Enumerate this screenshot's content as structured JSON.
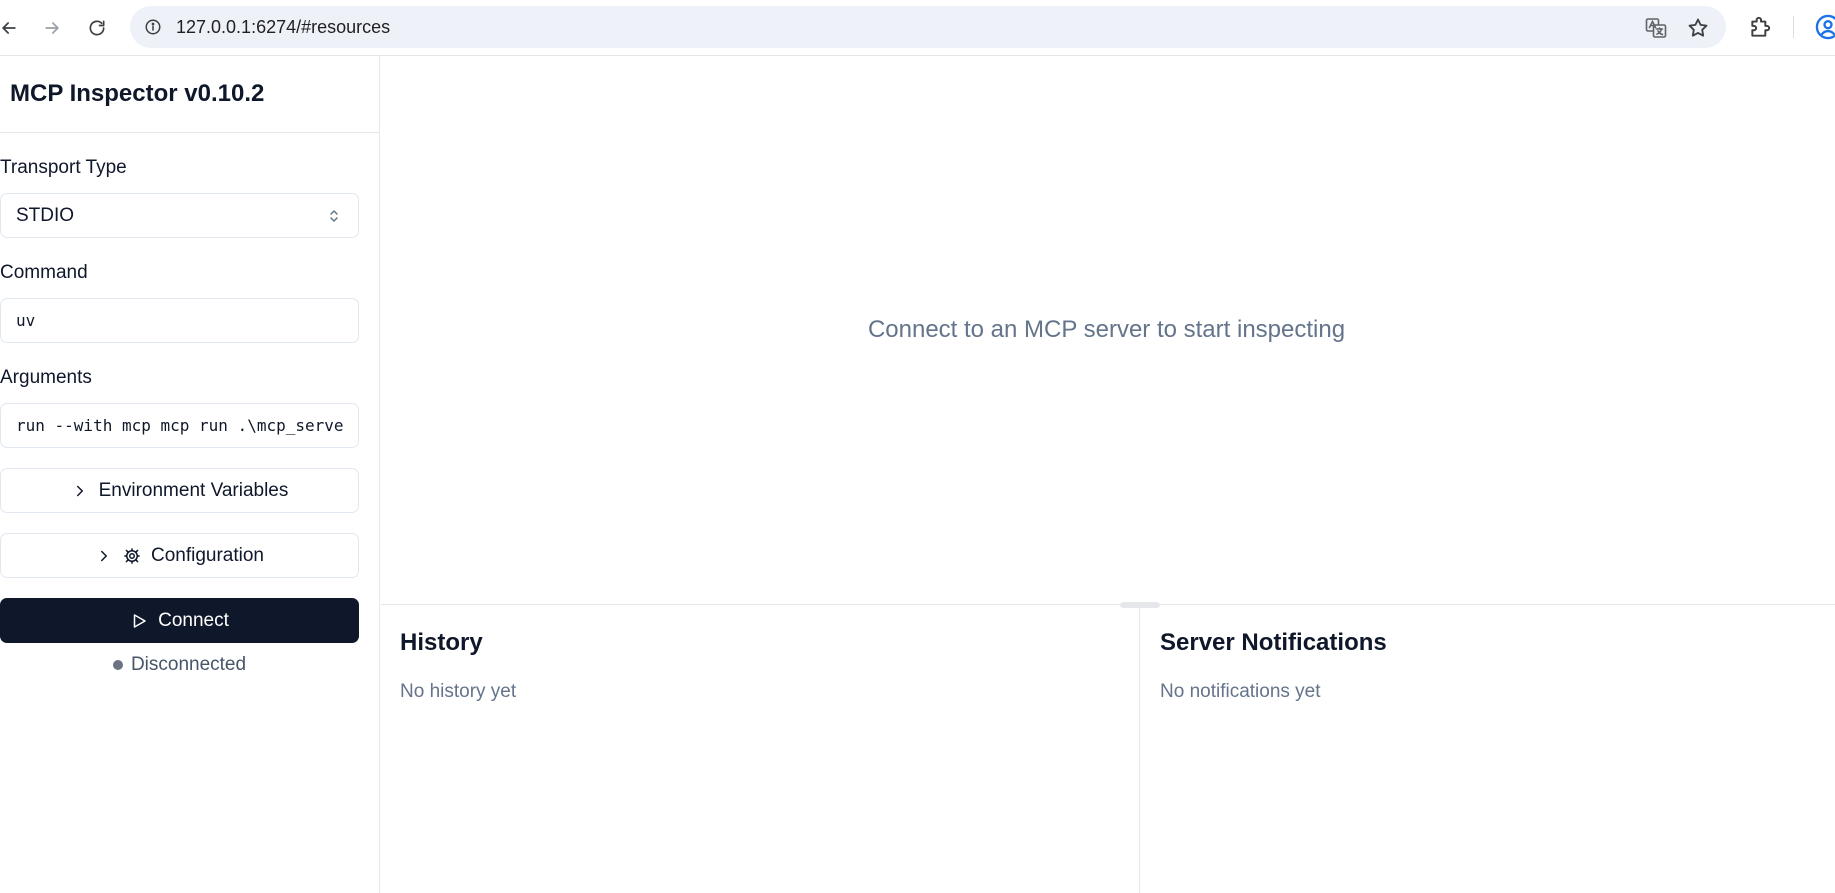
{
  "browser": {
    "url": "127.0.0.1:6274/#resources"
  },
  "sidebar": {
    "title": "MCP Inspector v0.10.2",
    "transport_label": "Transport Type",
    "transport_value": "STDIO",
    "command_label": "Command",
    "command_value": "uv",
    "arguments_label": "Arguments",
    "arguments_value": "run --with mcp mcp run .\\mcp_serve",
    "env_button_label": "Environment Variables",
    "config_button_label": "Configuration",
    "connect_button_label": "Connect",
    "status_text": "Disconnected",
    "status_color": "#6b7280"
  },
  "main": {
    "empty_message": "Connect to an MCP server to start inspecting"
  },
  "history": {
    "title": "History",
    "empty_text": "No history yet"
  },
  "notifications": {
    "title": "Server Notifications",
    "empty_text": "No notifications yet"
  },
  "icons": {
    "back": "arrow-left-icon",
    "forward": "arrow-right-icon",
    "reload": "reload-icon",
    "info": "info-icon",
    "translate": "translate-icon",
    "star": "star-icon",
    "extensions": "puzzle-icon",
    "profile": "profile-icon",
    "select": "chevron-up-down-icon",
    "expand": "chevron-right-icon",
    "settings": "gear-icon",
    "play": "play-icon"
  }
}
